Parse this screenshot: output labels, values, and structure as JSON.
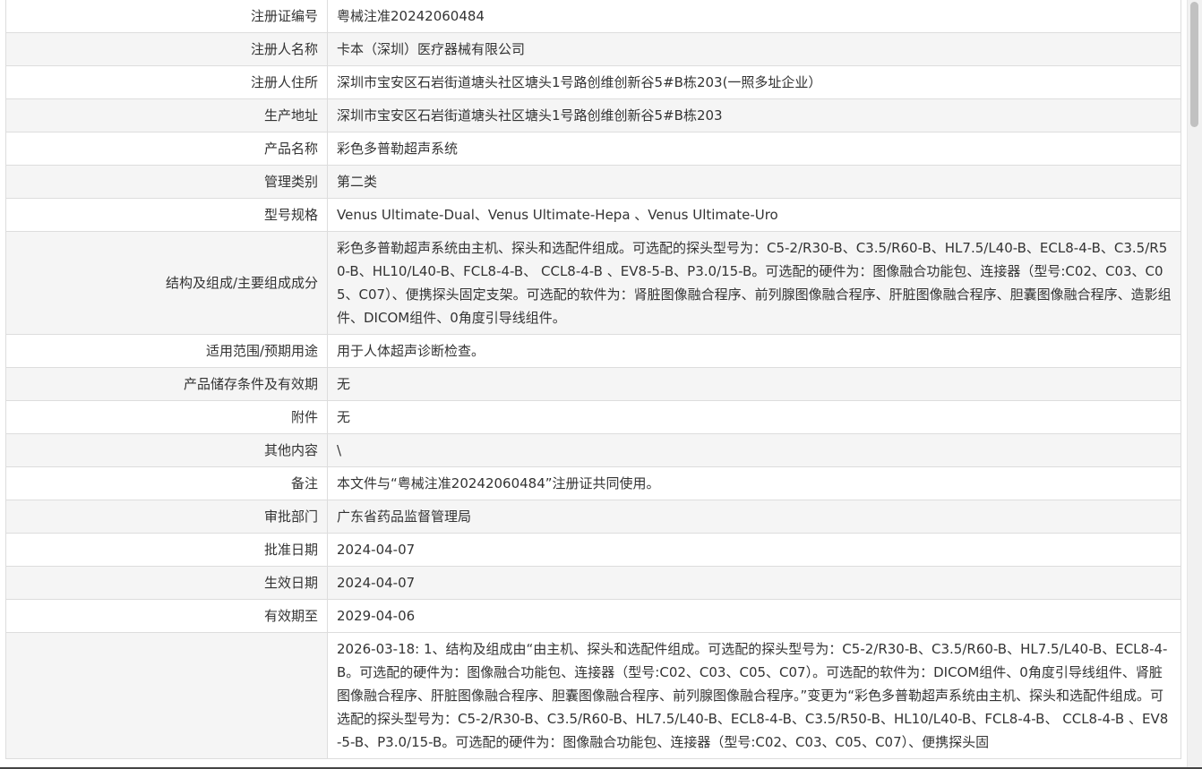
{
  "rows": [
    {
      "label": "注册证编号",
      "value": "粤械注准20242060484"
    },
    {
      "label": "注册人名称",
      "value": "卡本（深圳）医疗器械有限公司"
    },
    {
      "label": "注册人住所",
      "value": "深圳市宝安区石岩街道塘头社区塘头1号路创维创新谷5#B栋203(一照多址企业）"
    },
    {
      "label": "生产地址",
      "value": "深圳市宝安区石岩街道塘头社区塘头1号路创维创新谷5#B栋203"
    },
    {
      "label": "产品名称",
      "value": "彩色多普勒超声系统"
    },
    {
      "label": "管理类别",
      "value": "第二类"
    },
    {
      "label": "型号规格",
      "value": "Venus Ultimate-Dual、Venus Ultimate-Hepa 、Venus Ultimate-Uro"
    },
    {
      "label": "结构及组成/主要组成成分",
      "value": "彩色多普勒超声系统由主机、探头和选配件组成。可选配的探头型号为：C5-2/R30-B、C3.5/R60-B、HL7.5/L40-B、ECL8-4-B、C3.5/R50-B、HL10/L40-B、FCL8-4-B、 CCL8-4-B 、EV8-5-B、P3.0/15-B。可选配的硬件为：图像融合功能包、连接器（型号:C02、C03、C05、C07）、便携探头固定支架。可选配的软件为：肾脏图像融合程序、前列腺图像融合程序、肝脏图像融合程序、胆囊图像融合程序、造影组件、DICOM组件、0角度引导线组件。"
    },
    {
      "label": "适用范围/预期用途",
      "value": "用于人体超声诊断检查。"
    },
    {
      "label": "产品储存条件及有效期",
      "value": "无"
    },
    {
      "label": "附件",
      "value": "无"
    },
    {
      "label": "其他内容",
      "value": "\\"
    },
    {
      "label": "备注",
      "value": "本文件与“粤械注准20242060484”注册证共同使用。"
    },
    {
      "label": "审批部门",
      "value": "广东省药品监督管理局"
    },
    {
      "label": "批准日期",
      "value": "2024-04-07"
    },
    {
      "label": "生效日期",
      "value": "2024-04-07"
    },
    {
      "label": "有效期至",
      "value": "2029-04-06"
    },
    {
      "label": "",
      "value": "2026-03-18: 1、结构及组成由“由主机、探头和选配件组成。可选配的探头型号为：C5-2/R30-B、C3.5/R60-B、HL7.5/L40-B、ECL8-4-B。可选配的硬件为：图像融合功能包、连接器（型号:C02、C03、C05、C07）。可选配的软件为：DICOM组件、0角度引导线组件、肾脏图像融合程序、肝脏图像融合程序、胆囊图像融合程序、前列腺图像融合程序。”变更为“彩色多普勒超声系统由主机、探头和选配件组成。可选配的探头型号为：C5-2/R30-B、C3.5/R60-B、HL7.5/L40-B、ECL8-4-B、C3.5/R50-B、HL10/L40-B、FCL8-4-B、 CCL8-4-B 、EV8-5-B、P3.0/15-B。可选配的硬件为：图像融合功能包、连接器（型号:C02、C03、C05、C07）、便携探头固"
    }
  ]
}
